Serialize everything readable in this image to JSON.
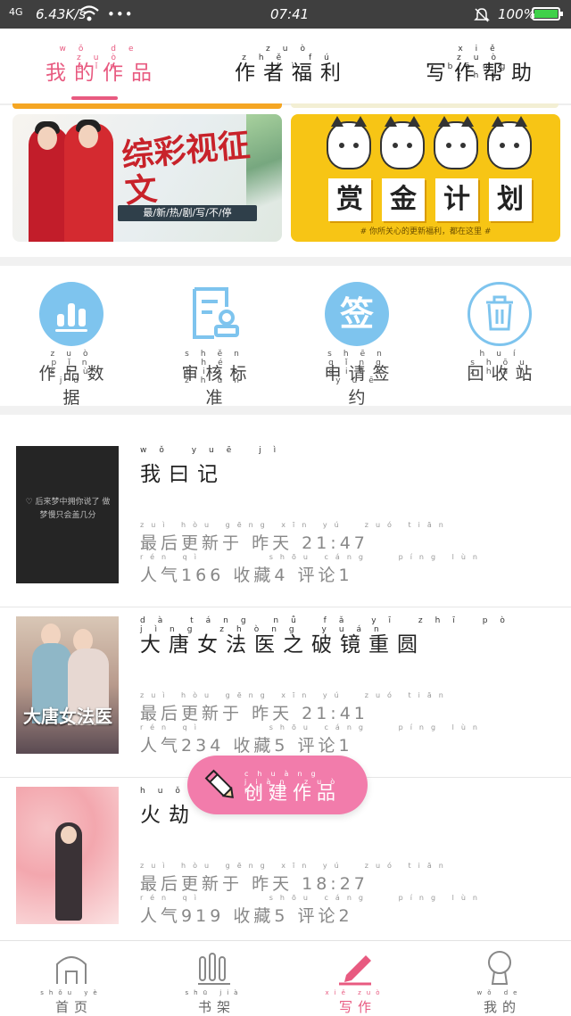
{
  "status_bar": {
    "network": "4G",
    "speed": "6.43K/s",
    "dots": "•••",
    "time": "07:41",
    "battery": "100%"
  },
  "tabs": [
    {
      "label": "我的作品",
      "pinyin": "wǒ de zuò pǐn",
      "active": true
    },
    {
      "label": "作者福利",
      "pinyin": "zuò zhě fú lì",
      "active": false
    },
    {
      "label": "写作帮助",
      "pinyin": "xiě zuò bāng zhù",
      "active": false
    }
  ],
  "banners": {
    "left": {
      "title": "综彩视征文",
      "subtitle": "最/新/热/剧/写/不/停"
    },
    "right": {
      "title_chars": [
        "赏",
        "金",
        "计",
        "划"
      ],
      "note": "# 你所关心的更新福利，都在这里 #"
    }
  },
  "tools": [
    {
      "label": "作品数据",
      "pinyin": "zuò pǐn shù jù",
      "icon": "bar-chart-icon"
    },
    {
      "label": "审核标准",
      "pinyin": "shěn hé biāo zhǔn",
      "icon": "document-stamp-icon"
    },
    {
      "label": "申请签约",
      "pinyin": "shēn qǐng qiān yuē",
      "icon": "sign-icon",
      "icon_text": "签"
    },
    {
      "label": "回收站",
      "pinyin": "huí shōu zhàn",
      "icon": "trash-icon"
    }
  ],
  "works": [
    {
      "title": "我曰记",
      "title_pinyin": "wǒ yuē jì",
      "update_label": "最后更新于",
      "update_pinyin": "zuì hòu gēng xīn yú",
      "update_day": "昨天",
      "update_day_pinyin": "zuó tiān",
      "update_time": "21:47",
      "popularity_label": "人气",
      "popularity_pinyin": "rén qì",
      "popularity": "166",
      "favorites_label": "收藏",
      "favorites_pinyin": "shōu cáng",
      "favorites": "4",
      "comments_label": "评论",
      "comments_pinyin": "píng lùn",
      "comments": "1",
      "cover_text": "♡ 后来梦中拥你说了 做梦慢只会盖几分"
    },
    {
      "title": "大唐女法医之破镜重圆",
      "title_pinyin": "dà táng nǚ fǎ yī zhī pò jìng zhòng yuán",
      "update_label": "最后更新于",
      "update_pinyin": "zuì hòu gēng xīn yú",
      "update_day": "昨天",
      "update_day_pinyin": "zuó tiān",
      "update_time": "21:41",
      "popularity_label": "人气",
      "popularity_pinyin": "rén qì",
      "popularity": "234",
      "favorites_label": "收藏",
      "favorites_pinyin": "shōu cáng",
      "favorites": "5",
      "comments_label": "评论",
      "comments_pinyin": "píng lùn",
      "comments": "1",
      "cover_text": "大唐女法医"
    },
    {
      "title": "火劫",
      "title_pinyin": "huǒ jié",
      "update_label": "最后更新于",
      "update_pinyin": "zuì hòu gēng xīn yú",
      "update_day": "昨天",
      "update_day_pinyin": "zuó tiān",
      "update_time": "18:27",
      "popularity_label": "人气",
      "popularity_pinyin": "rén qì",
      "popularity": "919",
      "favorites_label": "收藏",
      "favorites_pinyin": "shōu cáng",
      "favorites": "5",
      "comments_label": "评论",
      "comments_pinyin": "píng lùn",
      "comments": "2",
      "cover_text": ""
    }
  ],
  "fab": {
    "label": "创建作品",
    "pinyin": "chuàng jiàn zuò pǐn"
  },
  "bottom_nav": [
    {
      "label": "首页",
      "pinyin": "shǒu yè",
      "icon": "home-icon",
      "active": false
    },
    {
      "label": "书架",
      "pinyin": "shū jià",
      "icon": "bookshelf-icon",
      "active": false
    },
    {
      "label": "写作",
      "pinyin": "xiě zuò",
      "icon": "pen-icon",
      "active": true
    },
    {
      "label": "我的",
      "pinyin": "wǒ de",
      "icon": "user-icon",
      "active": false
    }
  ],
  "colors": {
    "accent": "#e85a80",
    "fab": "#f27cab",
    "icon_blue": "#7ec4ee",
    "banner_yellow": "#f7c515"
  }
}
